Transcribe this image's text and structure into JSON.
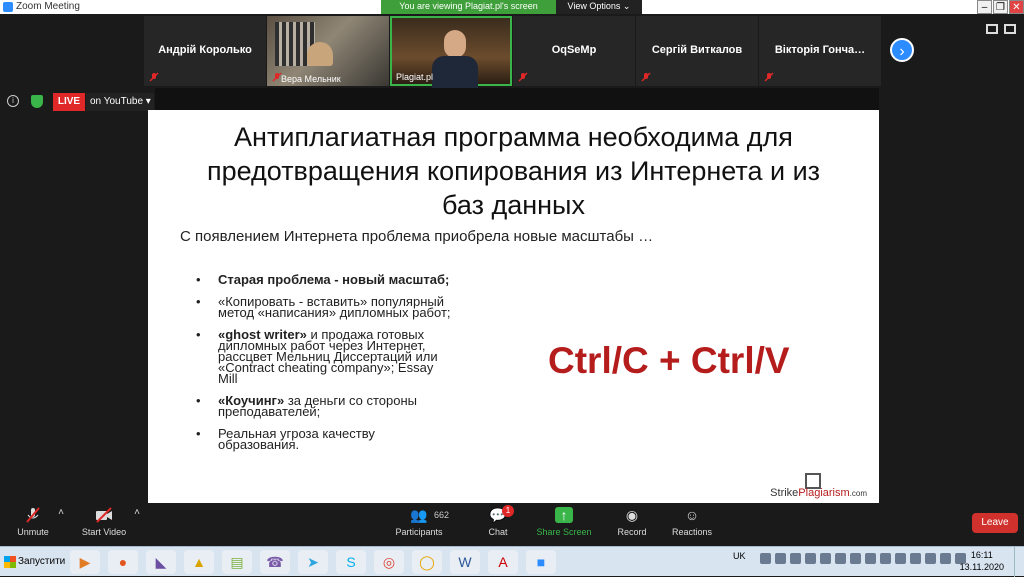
{
  "window": {
    "title": "Zoom Meeting",
    "minimize": "–",
    "restore": "❐",
    "close": "✕"
  },
  "banner": {
    "viewing_text": "You are viewing Plagiat.pl's screen",
    "view_options_label": "View Options ⌄"
  },
  "participants_strip": [
    {
      "name": "Андрій Королько",
      "type": "name-only"
    },
    {
      "name": "Вера Мельник",
      "type": "video"
    },
    {
      "name": "Plagiat.pl",
      "type": "host-video"
    },
    {
      "name": "OqSeMp",
      "type": "name-only"
    },
    {
      "name": "Сергій Виткалов",
      "type": "name-only"
    },
    {
      "name": "Вікторія  Гонча…",
      "type": "name-only"
    }
  ],
  "live": {
    "badge": "LIVE",
    "platform": "on YouTube ▾"
  },
  "slide": {
    "title": "Антиплагиатная программа необходима для\nпредотвращения копирования из Интернета и из\nбаз данных",
    "subtitle": "С появлением Интернета проблема приобрела новые масштабы …",
    "bullets": [
      {
        "html_strong": "Старая проблема - новый масштаб;",
        "rest": ""
      },
      {
        "html_strong": "",
        "rest": "«Копировать - вставить» популярный метод «написания» дипломных работ;"
      },
      {
        "html_strong": "«ghost writer»",
        "rest": " и продажа готовых дипломных работ через Интернет, рассцвет Мельниц Диссертаций или «Contract cheating company»; Essay Mill"
      },
      {
        "html_strong": "«Коучинг»",
        "rest": " за деньги со стороны преподавателей;"
      },
      {
        "html_strong": "",
        "rest": "Реальная угроза качеству образования."
      }
    ],
    "ctrl_text": "Ctrl/C + Ctrl/V",
    "brand_strike": "Strike",
    "brand_plagiarism": "Plagiarism",
    "brand_domain": ".com"
  },
  "toolbar": {
    "unmute": "Unmute",
    "start_video": "Start Video",
    "participants": "Participants",
    "participants_count": "662",
    "chat": "Chat",
    "chat_badge": "1",
    "share_screen": "Share Screen",
    "record": "Record",
    "reactions": "Reactions",
    "leave": "Leave"
  },
  "taskbar": {
    "start_label": "Запустити",
    "lang": "UK",
    "time": "16:11",
    "date": "13.11.2020"
  },
  "colors": {
    "zoom_blue": "#2d8cff",
    "live_red": "#e02828",
    "ctrl_red": "#b51c1c",
    "share_green": "#39b54a"
  }
}
